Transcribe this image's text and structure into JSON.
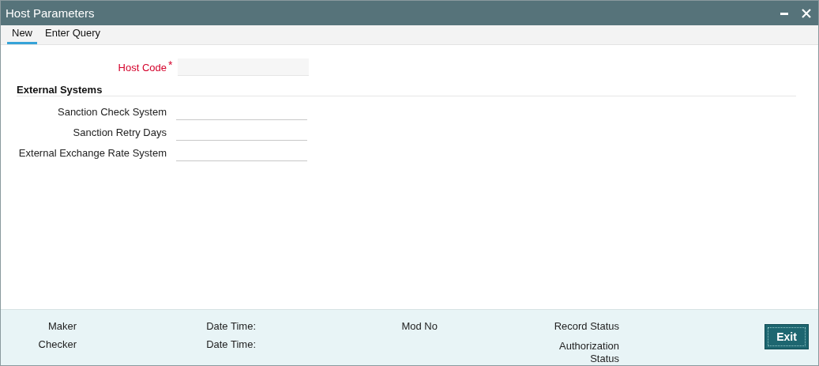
{
  "window": {
    "title": "Host Parameters"
  },
  "tabs": [
    {
      "label": "New",
      "selected": true
    },
    {
      "label": "Enter Query",
      "selected": false
    }
  ],
  "host_code": {
    "label": "Host Code",
    "required_marker": "*"
  },
  "external_systems": {
    "heading": "External Systems",
    "fields": [
      {
        "label": "Sanction Check System"
      },
      {
        "label": "Sanction Retry Days"
      },
      {
        "label": "External Exchange Rate System"
      }
    ]
  },
  "footer": {
    "columns": [
      [
        "Maker",
        "Checker"
      ],
      [
        "Date Time:",
        "Date Time:"
      ],
      [
        "Mod No"
      ],
      [
        "Record Status",
        "Authorization Status"
      ]
    ],
    "button": "Exit"
  }
}
